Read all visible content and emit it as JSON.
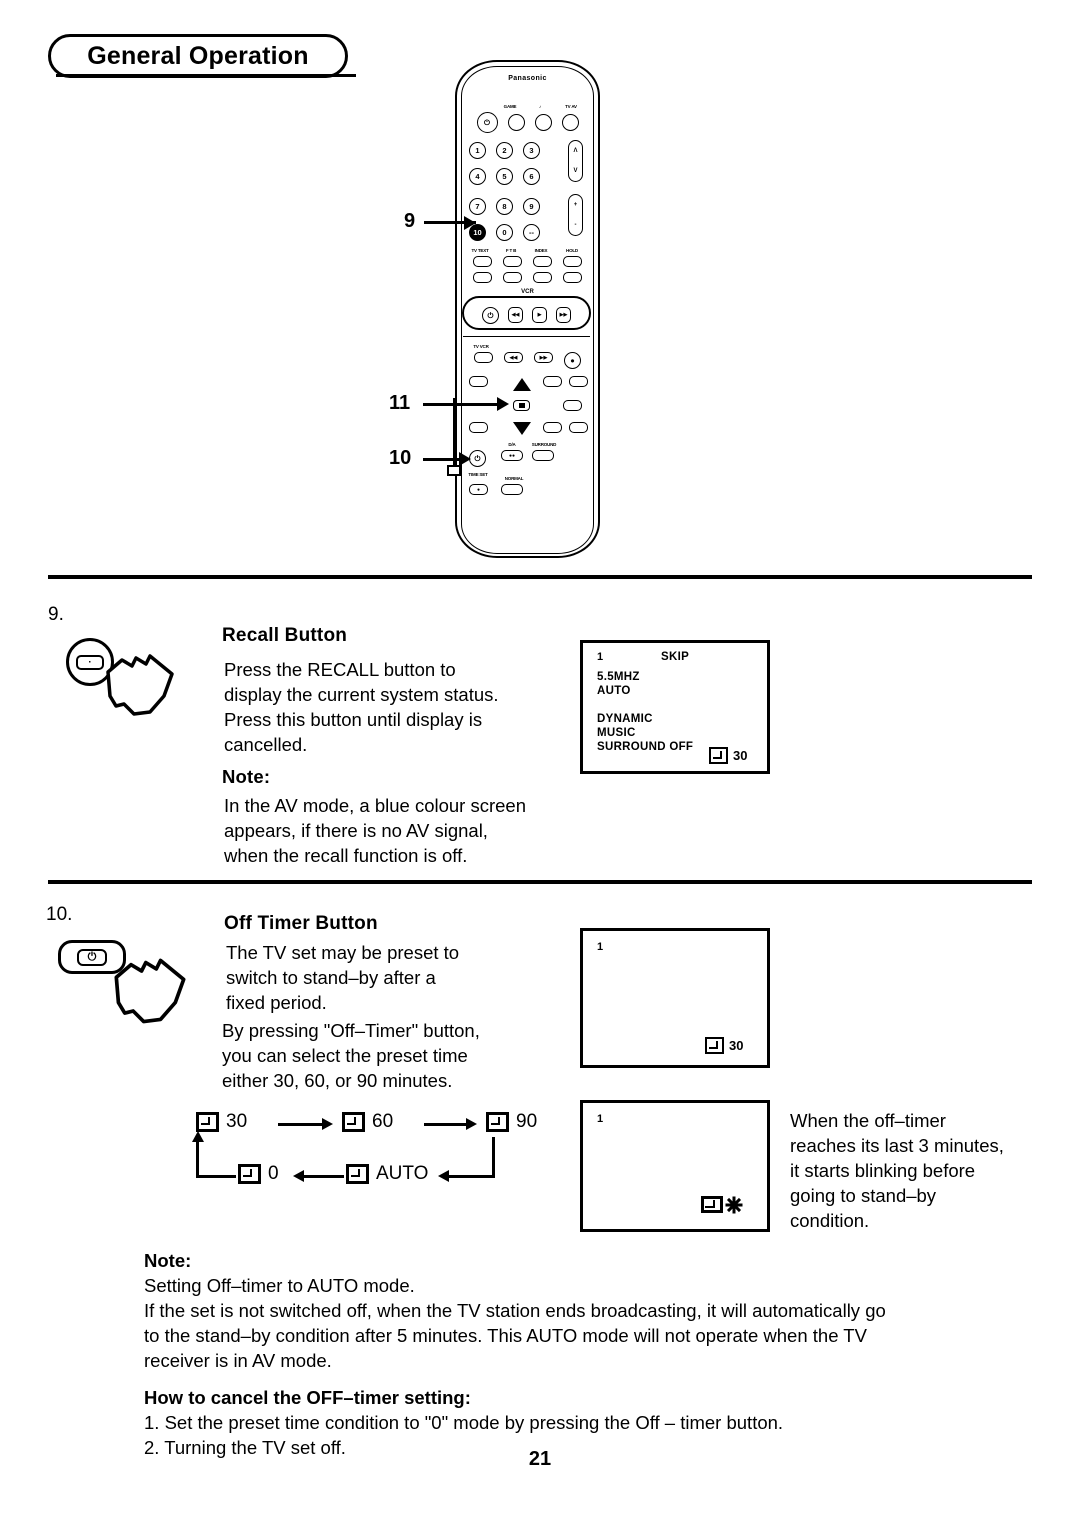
{
  "header": {
    "title": "General Operation"
  },
  "page_number": "21",
  "remote": {
    "brand": "Panasonic",
    "top_labels": [
      "",
      "GAME",
      "MUTE",
      "TV AV"
    ],
    "keys_row1": [
      "1",
      "2",
      "3"
    ],
    "keys_row2": [
      "4",
      "5",
      "6"
    ],
    "keys_row3": [
      "7",
      "8",
      "9"
    ],
    "keys_row4": [
      "10",
      "0",
      "--"
    ],
    "teletext_labels": [
      "TV TEXT",
      "F T B",
      "INDEX",
      "HOLD"
    ],
    "vcr_label": "VCR",
    "tv_vcr_label": "TV VCR",
    "volume_up": "+",
    "volume_down": "-",
    "channel_up": "Λ",
    "channel_down": "V"
  },
  "callouts": [
    {
      "id": "9",
      "label": "9"
    },
    {
      "id": "11",
      "label": "11"
    },
    {
      "id": "10",
      "label": "10"
    }
  ],
  "sections": [
    {
      "number": "9.",
      "title": "Recall Button",
      "body": "Press the RECALL button to\ndisplay the current system status.\nPress this button until display is\ncancelled.",
      "note_title": "Note:",
      "note_body": "In the AV mode, a blue colour screen\nappears, if there is no AV signal,\nwhen the recall function is off.",
      "osd": {
        "channel": "1",
        "skip": "SKIP",
        "lines": [
          "5.5MHZ",
          "AUTO"
        ],
        "lines2": [
          "DYNAMIC",
          "MUSIC",
          "SURROUND OFF"
        ],
        "timer_value": "30"
      }
    },
    {
      "number": "10.",
      "title": "Off Timer Button",
      "body": "The TV set may be preset to\nswitch to stand–by after a\nfixed period.",
      "body2": "By pressing \"Off–Timer\" button,\nyou can select the preset time\neither 30, 60, or 90 minutes.",
      "osd_top": {
        "channel": "1",
        "timer_value": "30"
      },
      "osd_bottom": {
        "channel": "1"
      },
      "blink_text": "When the off–timer\nreaches its last 3 minutes,\n it starts blinking before\ngoing to stand–by\ncondition."
    }
  ],
  "flow": {
    "steps": [
      "30",
      "60",
      "90",
      "AUTO",
      "0"
    ]
  },
  "bottom_note": {
    "title": "Note:",
    "line1": "Setting Off–timer to AUTO mode.",
    "line2": "If the set is not switched off, when the TV station ends broadcasting, it will automatically go",
    "line3": "to the stand–by condition after 5 minutes. This AUTO mode will not operate when the TV",
    "line4": "receiver is in AV mode.",
    "cancel_title": "How to cancel the OFF–timer setting:",
    "cancel_1": "1. Set the preset time condition to \"0\" mode by pressing the Off – timer button.",
    "cancel_2": "2. Turning the TV set off."
  }
}
